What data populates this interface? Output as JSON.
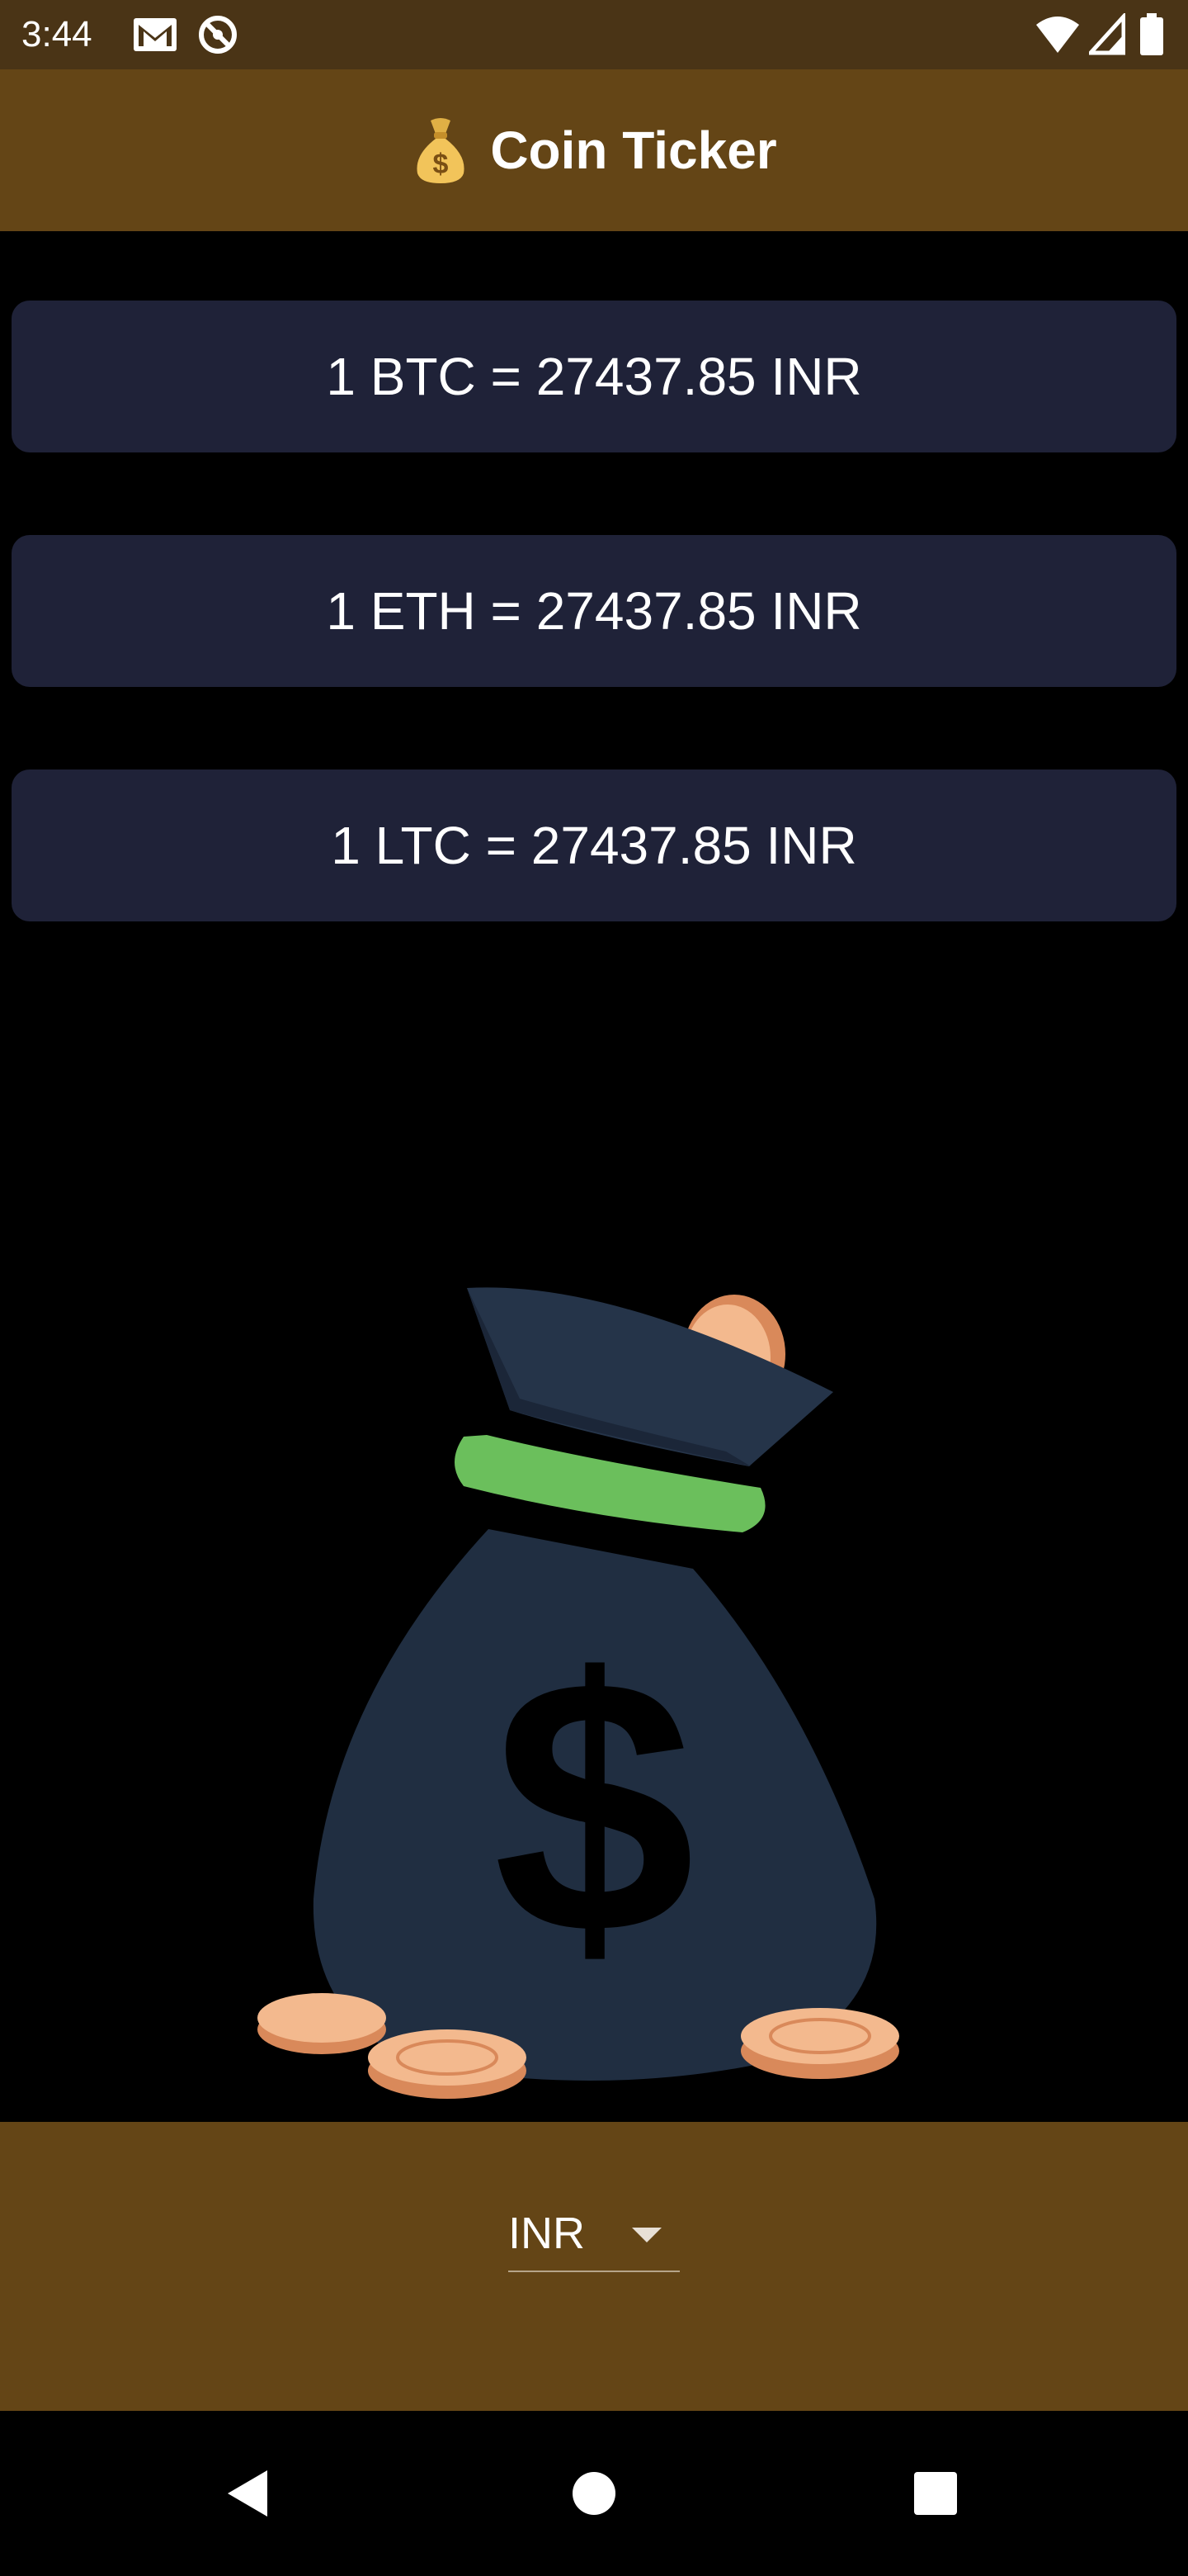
{
  "status_bar": {
    "time": "3:44",
    "left_icons": [
      "gmail-icon",
      "no-sync-icon"
    ],
    "right_icons": [
      "wifi-icon",
      "signal-icon",
      "battery-icon"
    ]
  },
  "app_bar": {
    "emoji": "money-bag-icon",
    "title": "Coin Ticker"
  },
  "rates": [
    {
      "text": "1 BTC = 27437.85 INR"
    },
    {
      "text": "1 ETH = 27437.85 INR"
    },
    {
      "text": "1 LTC = 27437.85 INR"
    }
  ],
  "illustration": "money-bag-with-coins",
  "currency_picker": {
    "selected": "INR"
  },
  "nav": [
    "back-icon",
    "home-icon",
    "recents-icon"
  ],
  "colors": {
    "status_bar": "#4a3416",
    "app_bar": "#644516",
    "card_bg": "#1f2238",
    "background": "#000000",
    "bag": "#202e41",
    "bag_band": "#6bbf5c",
    "coin": "#e9a57a"
  }
}
